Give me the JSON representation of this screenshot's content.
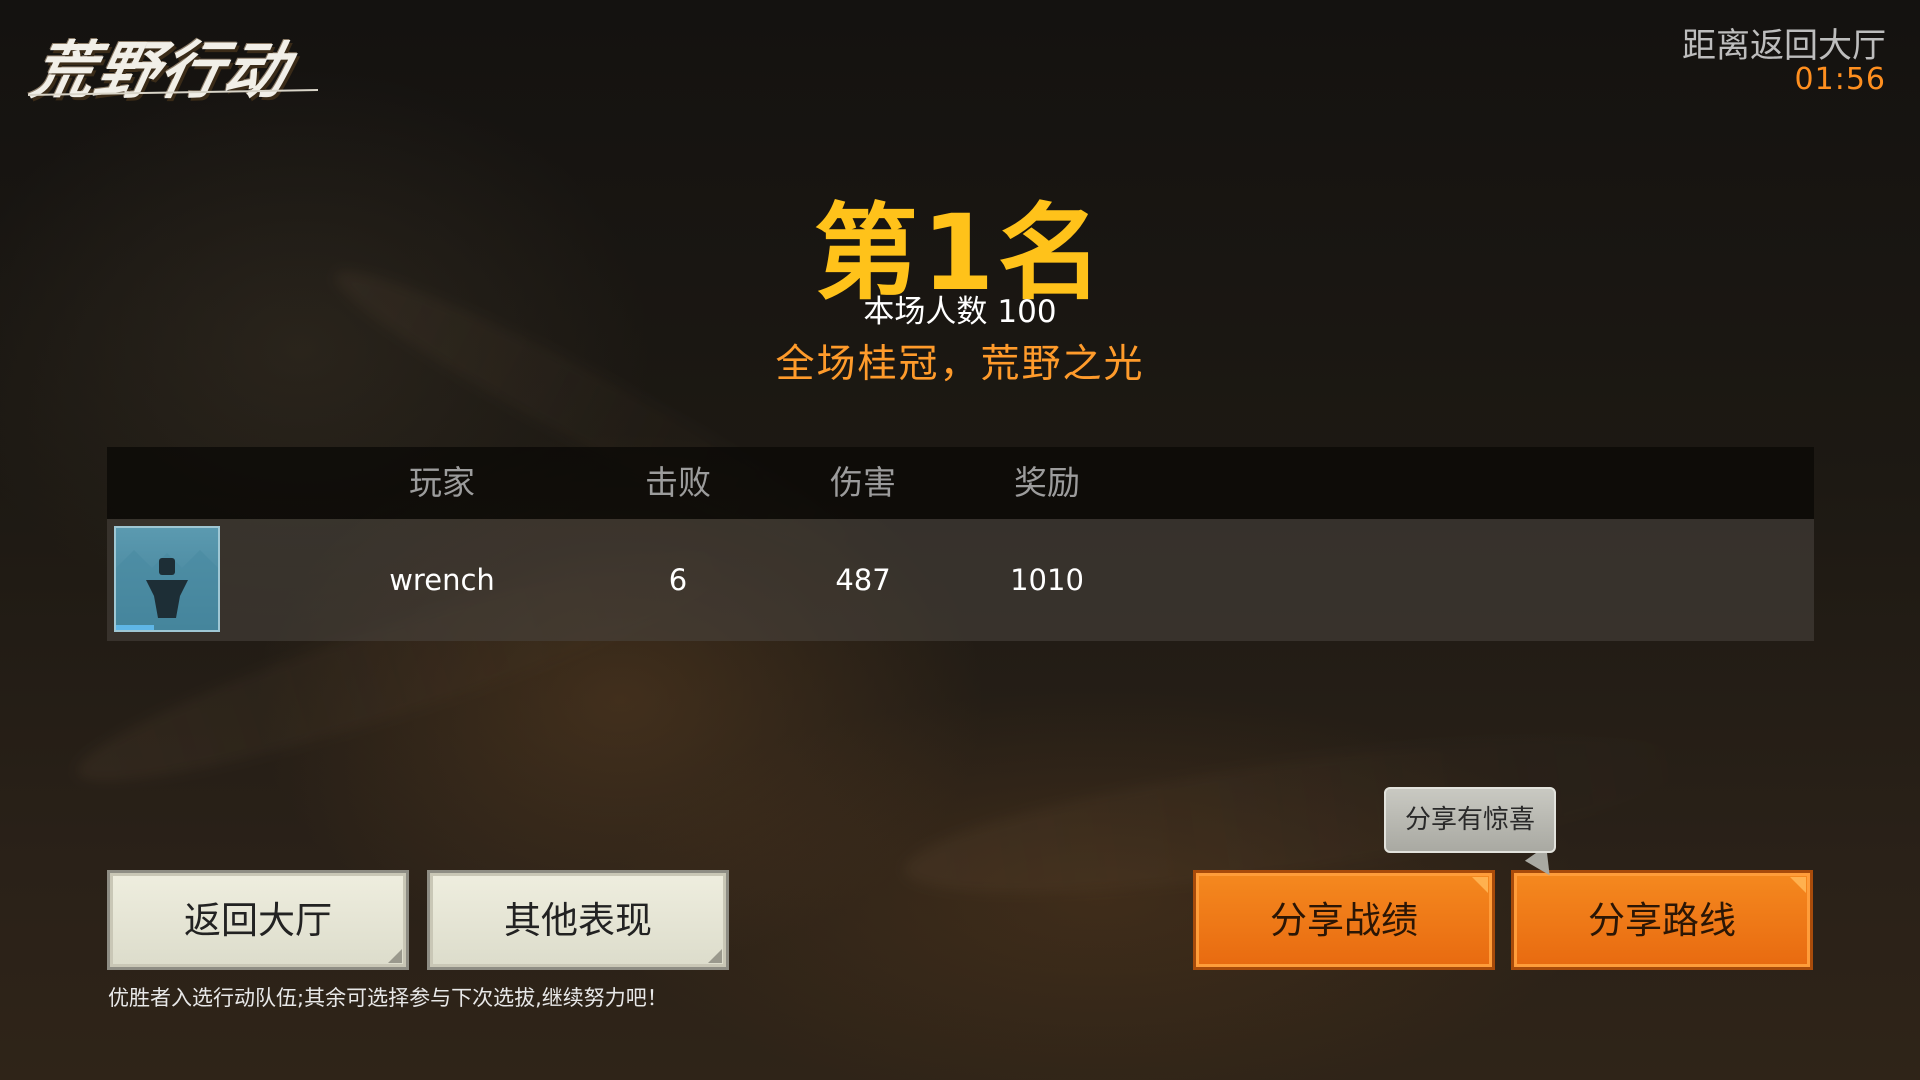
{
  "logo": {
    "text": "荒野行动"
  },
  "countdown": {
    "label": "距离返回大厅",
    "time": "01:56"
  },
  "result": {
    "rank": "第1名",
    "players_label": "本场人数",
    "players_count": "100",
    "slogan": "全场桂冠，荒野之光"
  },
  "table": {
    "headers": {
      "player": "玩家",
      "kills": "击败",
      "damage": "伤害",
      "reward": "奖励"
    },
    "rows": [
      {
        "player": "wrench",
        "kills": "6",
        "damage": "487",
        "reward": "1010",
        "avatar_icon": "soldier-silhouette-icon"
      }
    ]
  },
  "buttons": {
    "back_lobby": "返回大厅",
    "other_performance": "其他表现",
    "share_record": "分享战绩",
    "share_route": "分享路线"
  },
  "tooltip": {
    "text": "分享有惊喜"
  },
  "footnote": "优胜者入选行动队伍;其余可选择参与下次选拔,继续努力吧！",
  "colors": {
    "rank": "#ffc21a",
    "slogan": "#ff9b2b",
    "countdown_time": "#ff8f1f",
    "orange_button": "#f0801a",
    "light_button": "#e6e5d5"
  }
}
